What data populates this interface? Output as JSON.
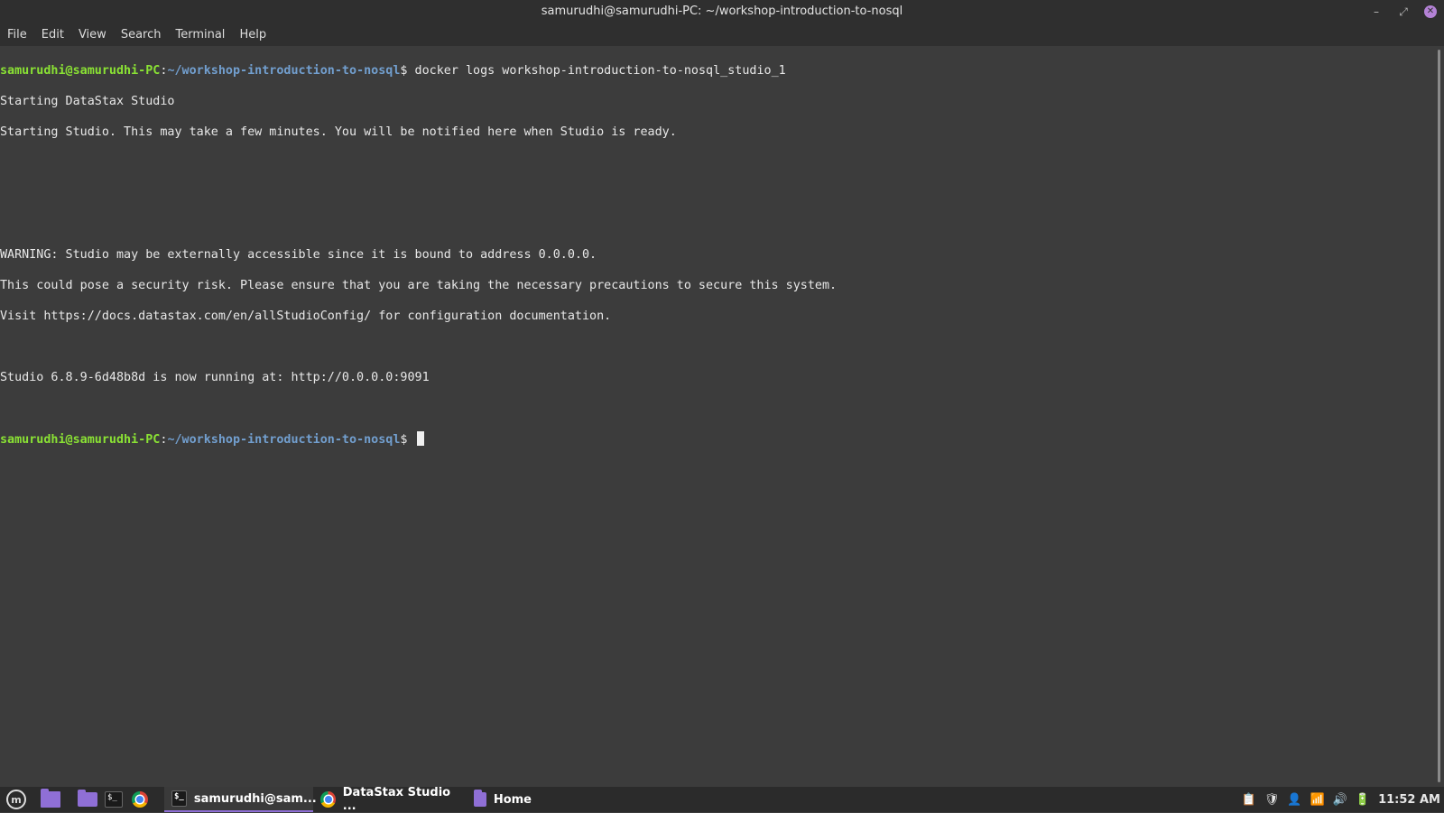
{
  "window": {
    "title": "samurudhi@samurudhi-PC: ~/workshop-introduction-to-nosql",
    "minimize": "–",
    "maximize": "⤢",
    "close": "✕"
  },
  "menu": [
    "File",
    "Edit",
    "View",
    "Search",
    "Terminal",
    "Help"
  ],
  "terminal": {
    "prompt_user": "samurudhi@samurudhi-PC",
    "prompt_sep": ":",
    "prompt_path": "~/workshop-introduction-to-nosql",
    "prompt_dollar": "$ ",
    "command": "docker logs workshop-introduction-to-nosql_studio_1",
    "output": [
      "Starting DataStax Studio",
      "Starting Studio. This may take a few minutes. You will be notified here when Studio is ready.",
      "",
      "",
      "",
      "WARNING: Studio may be externally accessible since it is bound to address 0.0.0.0.",
      "This could pose a security risk. Please ensure that you are taking the necessary precautions to secure this system.",
      "Visit https://docs.datastax.com/en/allStudioConfig/ for configuration documentation.",
      "",
      "Studio 6.8.9-6d48b8d is now running at: http://0.0.0.0:9091",
      ""
    ]
  },
  "taskbar": {
    "menu_logo": "m",
    "launchers": [
      "show-desktop",
      "files",
      "terminal",
      "chrome"
    ],
    "term_glyph": "$_",
    "tasks": [
      {
        "label": "samurudhi@sam...",
        "icon": "terminal-icon",
        "active": true
      },
      {
        "label": "DataStax Studio ...",
        "icon": "chrome-icon",
        "active": false
      },
      {
        "label": "Home",
        "icon": "folder-icon",
        "active": false
      }
    ],
    "clock": "11:52 AM"
  }
}
